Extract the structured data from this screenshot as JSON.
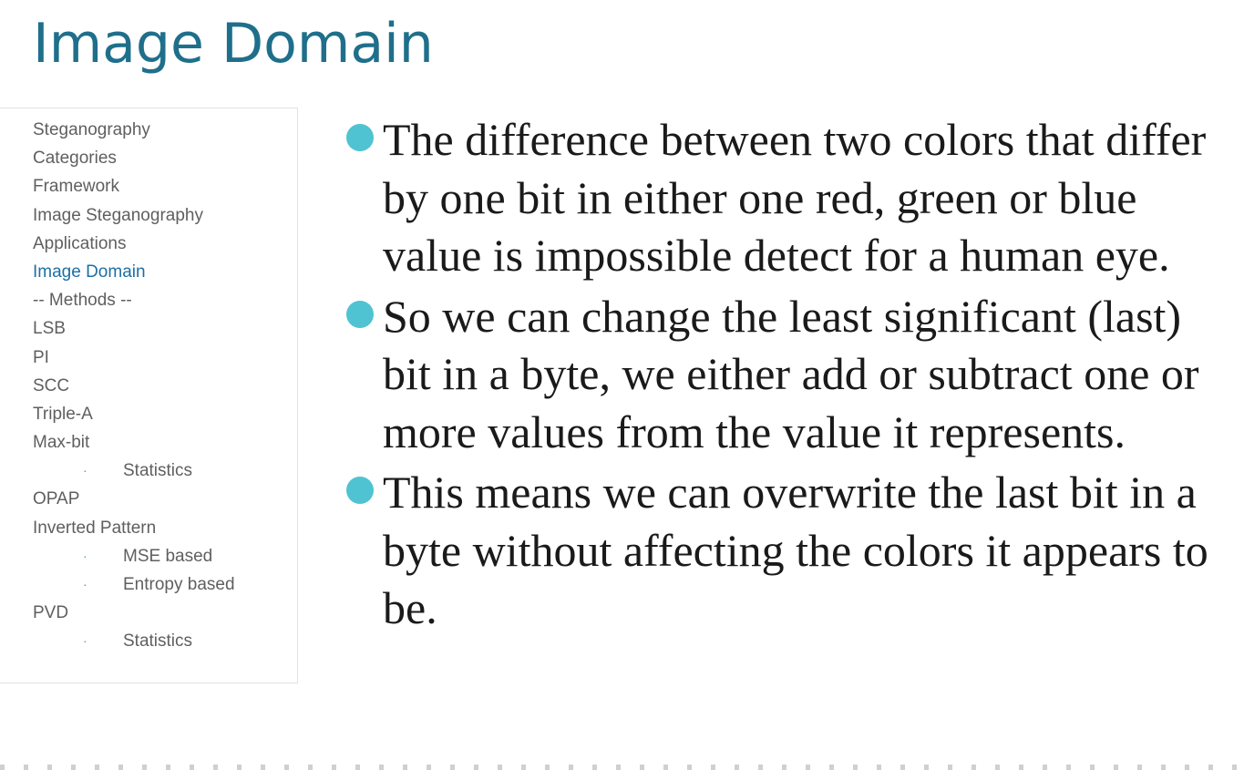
{
  "slide": {
    "title": "Image Domain"
  },
  "outline": {
    "items": [
      {
        "label": "Steganography",
        "level": 0,
        "active": false
      },
      {
        "label": "Categories",
        "level": 0,
        "active": false
      },
      {
        "label": "Framework",
        "level": 0,
        "active": false
      },
      {
        "label": "Image Steganography",
        "level": 0,
        "active": false
      },
      {
        "label": "Applications",
        "level": 0,
        "active": false
      },
      {
        "label": "Image Domain",
        "level": 0,
        "active": true
      },
      {
        "label": "-- Methods --",
        "level": 0,
        "active": false
      },
      {
        "label": "LSB",
        "level": 0,
        "active": false
      },
      {
        "label": "PI",
        "level": 0,
        "active": false
      },
      {
        "label": "SCC",
        "level": 0,
        "active": false
      },
      {
        "label": "Triple-A",
        "level": 0,
        "active": false
      },
      {
        "label": "Max-bit",
        "level": 0,
        "active": false
      },
      {
        "label": "Statistics",
        "level": 1,
        "active": false
      },
      {
        "label": "OPAP",
        "level": 0,
        "active": false
      },
      {
        "label": "Inverted Pattern",
        "level": 0,
        "active": false
      },
      {
        "label": "MSE based",
        "level": 1,
        "active": false
      },
      {
        "label": "Entropy based",
        "level": 1,
        "active": false
      },
      {
        "label": "PVD",
        "level": 0,
        "active": false
      },
      {
        "label": "Statistics",
        "level": 1,
        "active": false
      }
    ],
    "sub_bullet_glyph": "·"
  },
  "content": {
    "points": [
      "The difference between two colors that differ by one bit in either one red, green or blue value is impossible detect for a human eye.",
      "So we can change the least significant (last) bit in a byte, we either add or subtract one or more values from the value it represents.",
      "This means we can overwrite the last bit in a byte without affecting the colors it appears to be."
    ]
  },
  "colors": {
    "title": "#1f6f8b",
    "active_outline": "#1d6fa5",
    "bullet": "#4fc3d1"
  }
}
